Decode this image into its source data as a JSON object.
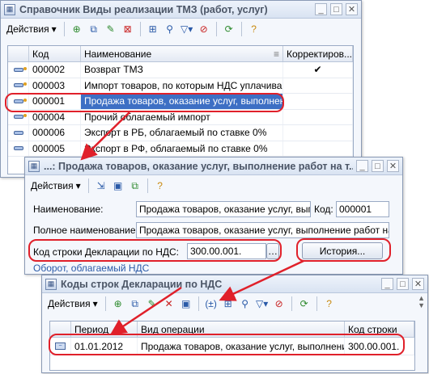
{
  "win1": {
    "title": "Справочник Виды реализации ТМЗ (работ, услуг)",
    "actions_label": "Действия",
    "columns": [
      "Код",
      "Наименование",
      "Корректиров..."
    ],
    "rows": [
      {
        "code": "000002",
        "name": "Возврат ТМЗ",
        "corr": "✔",
        "marked": true
      },
      {
        "code": "000003",
        "name": "Импорт товаров, по которым НДС уплачива...",
        "corr": "",
        "marked": true
      },
      {
        "code": "000001",
        "name": "Продажа товаров, оказание услуг, выполнен...",
        "corr": "",
        "marked": true
      },
      {
        "code": "000004",
        "name": "Прочий облагаемый импорт",
        "corr": "",
        "marked": true
      },
      {
        "code": "000006",
        "name": "Экспорт в РБ, облагаемый по ставке 0%",
        "corr": "",
        "marked": false
      },
      {
        "code": "000005",
        "name": "Экспорт в РФ, облагаемый по ставке 0%",
        "corr": "",
        "marked": false
      }
    ]
  },
  "win2": {
    "title": "...: Продажа товаров, оказание услуг, выполнение работ на т...",
    "actions_label": "Действия",
    "name_label": "Наименование:",
    "name_value": "Продажа товаров, оказание услуг, выпол",
    "code_label": "Код:",
    "code_value": "000001",
    "fullname_label": "Полное наименование:",
    "fullname_value": "Продажа товаров, оказание услуг, выполнение работ на тер",
    "decl_label": "Код строки Декларации по НДС:",
    "decl_value": "300.00.001.",
    "history_button": "История...",
    "link_text": "Оборот, облагаемый НДС"
  },
  "win3": {
    "title": "Коды строк Декларации по НДС",
    "actions_label": "Действия",
    "columns": [
      "Период",
      "Вид операции",
      "Код строки"
    ],
    "rows": [
      {
        "period": "01.01.2012",
        "op": "Продажа товаров, оказание услуг, выполнени...",
        "code": "300.00.001."
      }
    ]
  },
  "colors": {
    "selection": "#3d6fc4",
    "annotation": "#e0202a",
    "link": "#2a5aa8"
  }
}
